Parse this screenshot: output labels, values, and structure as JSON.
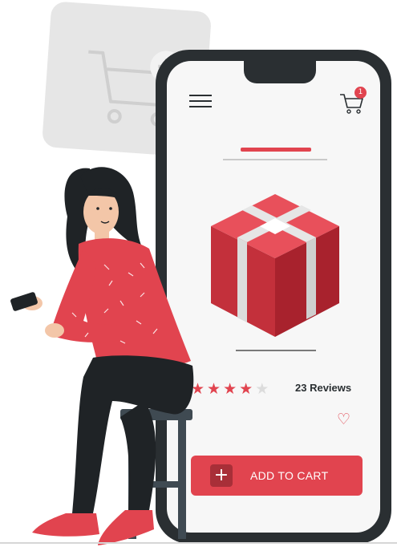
{
  "header": {
    "cart_icon": "shopping-cart-icon",
    "cart_badge_count": "1",
    "menu_icon": "hamburger-menu-icon"
  },
  "product": {
    "rating": 4,
    "rating_max": 5,
    "reviews_label": "23 Reviews",
    "favorite_icon": "heart-outline-icon"
  },
  "actions": {
    "add_to_cart_label": "ADD TO CART",
    "add_icon": "plus-icon"
  },
  "colors": {
    "accent": "#e1444f",
    "accent_dark": "#a82f38",
    "phone_frame": "#2a2f32",
    "screen_bg": "#f7f7f7",
    "star_off": "#dcdcdc"
  }
}
